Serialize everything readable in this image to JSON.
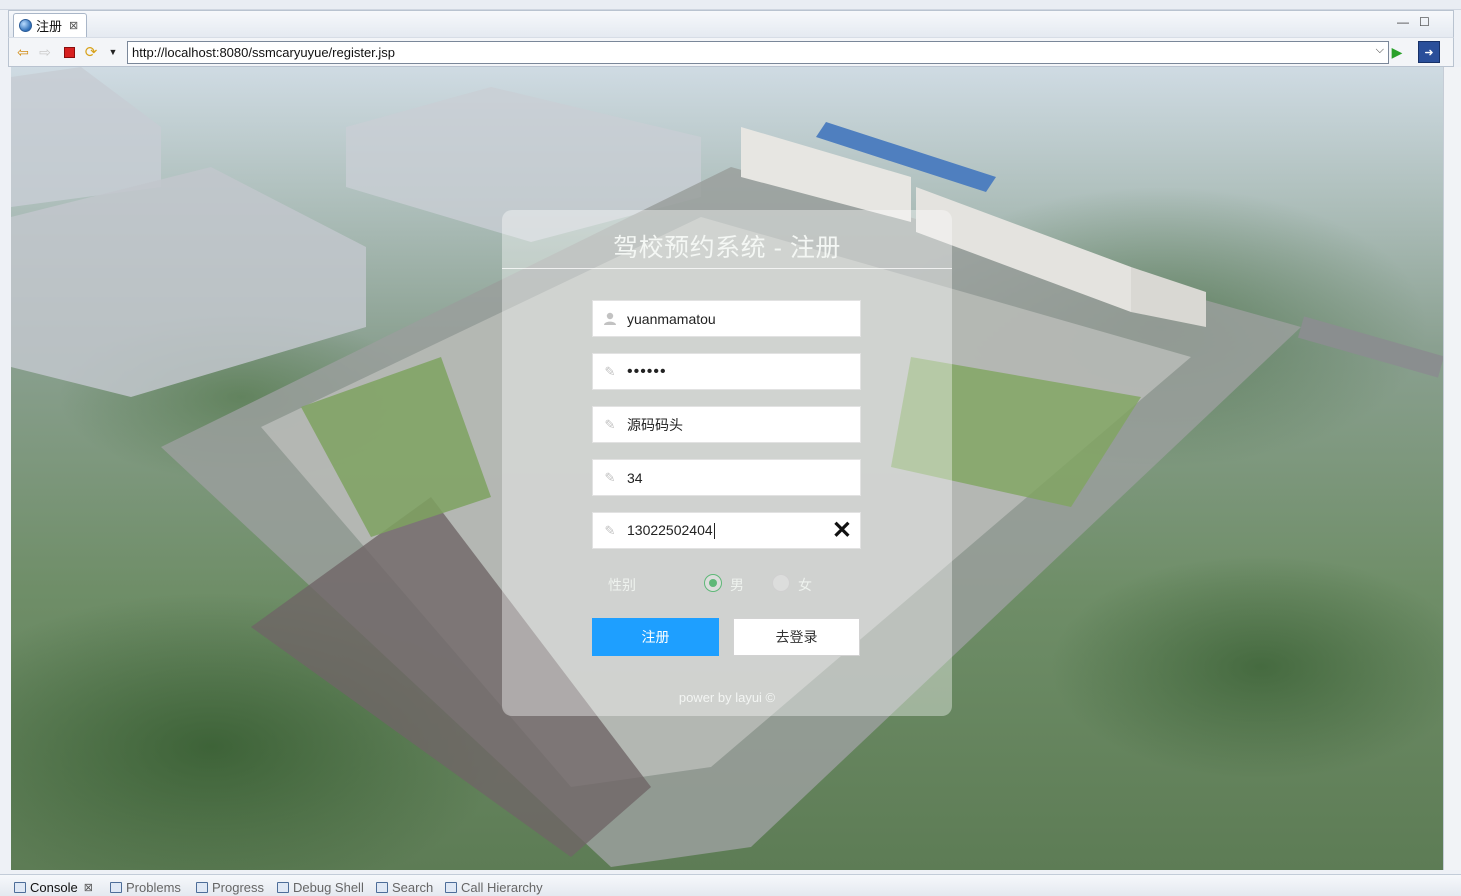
{
  "editor_tab": {
    "label": "注册",
    "close": "⊠"
  },
  "window_controls": {
    "minimize": "—",
    "maximize": "☐"
  },
  "browser": {
    "url": "http://localhost:8080/ssmcaryuyue/register.jsp"
  },
  "form": {
    "title": "驾校预约系统 - 注册",
    "username": "yuanmamatou",
    "password_mask": "••••••",
    "real_name": "源码码头",
    "age": "34",
    "phone": "13022502404",
    "gender_label": "性别",
    "gender_options": [
      "男",
      "女"
    ],
    "gender_selected": "男",
    "register_button": "注册",
    "login_button": "去登录",
    "footer": "power by layui ©"
  },
  "bottom_tabs": [
    "Console",
    "Problems",
    "Progress",
    "Debug Shell",
    "Search",
    "Call Hierarchy"
  ],
  "colors": {
    "primary_button": "#1e9fff",
    "radio_checked": "#5fb878"
  }
}
